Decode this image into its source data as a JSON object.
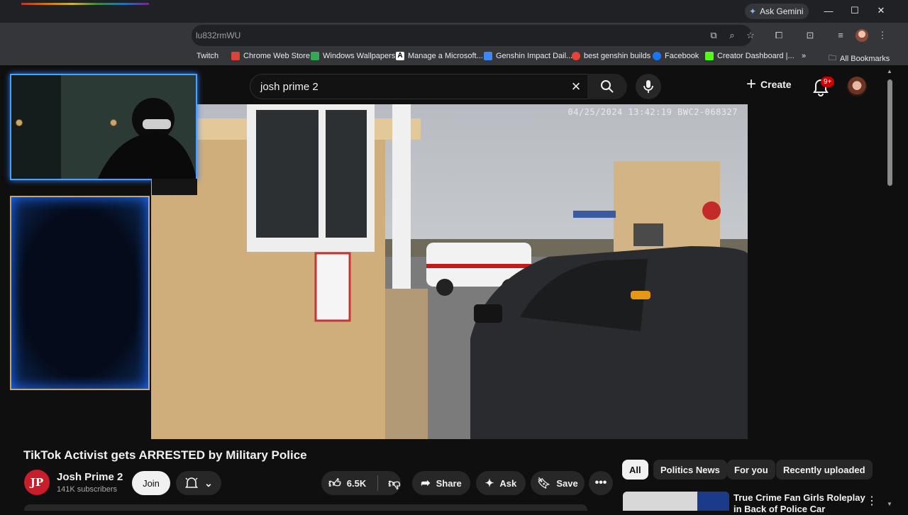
{
  "browser": {
    "ask_gemini": "Ask Gemini",
    "url_fragment": "lu832rmWU",
    "bookmarks": [
      {
        "label": "Twitch",
        "color": "#9146ff"
      },
      {
        "label": "Chrome Web Store",
        "color": "#db4437"
      },
      {
        "label": "Windows Wallpapers",
        "color": "#34a853"
      },
      {
        "label": "Manage a Microsoft...",
        "color": "#ffffff"
      },
      {
        "label": "Genshin Impact Dail...",
        "color": "#4285f4"
      },
      {
        "label": "best genshin builds",
        "color": "#ea4335"
      },
      {
        "label": "Facebook",
        "color": "#1877f2"
      },
      {
        "label": "Creator Dashboard |...",
        "color": "#53fc18"
      }
    ],
    "overflow": "»",
    "all_bookmarks": "All Bookmarks"
  },
  "youtube": {
    "search_query": "josh prime 2",
    "create_label": "Create",
    "notification_badge": "9+",
    "video": {
      "timestamp": "04/25/2024 13:42:19   BWC2-068327"
    },
    "title": "TikTok Activist gets ARRESTED by Military Police",
    "channel": {
      "avatar_text": "JP",
      "name": "Josh Prime 2",
      "subscribers": "141K subscribers",
      "join_label": "Join"
    },
    "actions": {
      "likes": "6.5K",
      "share": "Share",
      "ask": "Ask",
      "save": "Save"
    },
    "chips": [
      "All",
      "Politics News",
      "For you",
      "Recently uploaded"
    ],
    "recommendation": {
      "title": "True Crime Fan Girls Roleplay in Back of Police Car"
    }
  }
}
